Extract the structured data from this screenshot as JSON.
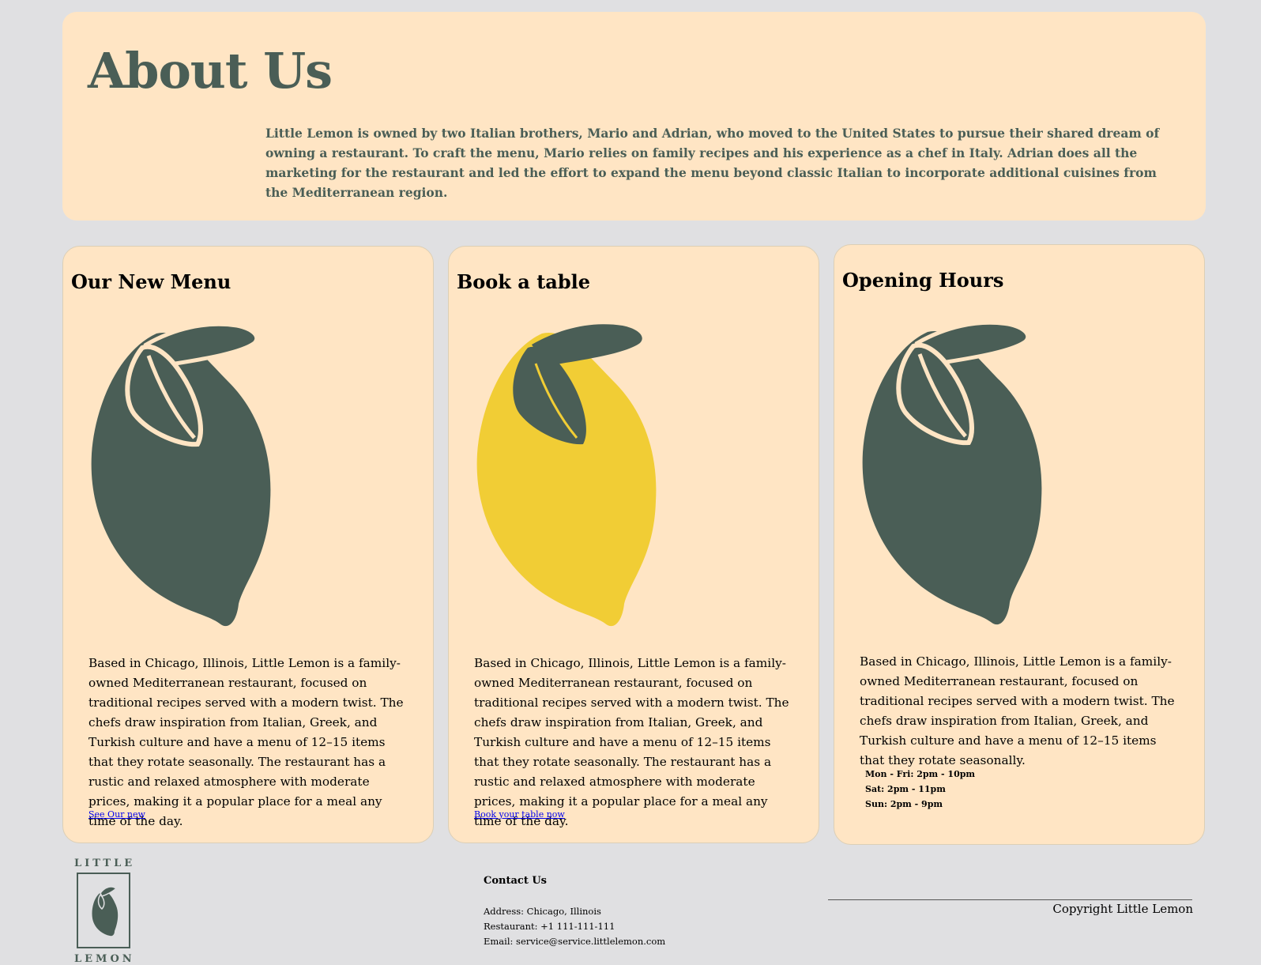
{
  "about": {
    "title": "About Us",
    "text": "Little Lemon is owned by two Italian brothers, Mario and Adrian, who moved to the United States to pursue their shared dream of owning a restaurant. To craft the menu, Mario relies on family recipes and his experience as a chef in Italy. Adrian does all the marketing for the restaurant and led the effort to expand the menu beyond classic Italian to incorporate additional cuisines from the Mediterranean region."
  },
  "cards": [
    {
      "title": "Our New Menu",
      "image": "lemon-dark",
      "body": "Based in Chicago, Illinois, Little Lemon is a family-owned Mediterranean restaurant, focused on traditional recipes served with a modern twist. The chefs draw inspiration from Italian, Greek, and Turkish culture and have a menu of 12–15 items that they rotate seasonally. The restaurant has a rustic and relaxed atmosphere with moderate prices, making it a popular place for a meal any time of the day.",
      "link": "See Our new"
    },
    {
      "title": "Book a table",
      "image": "lemon-yellow",
      "body": "Based in Chicago, Illinois, Little Lemon is a family-owned Mediterranean restaurant, focused on traditional recipes served with a modern twist. The chefs draw inspiration from Italian, Greek, and Turkish culture and have a menu of 12–15 items that they rotate seasonally. The restaurant has a rustic and relaxed atmosphere with moderate prices, making it a popular place for a meal any time of the day.",
      "link": "Book your table now"
    },
    {
      "title": "Opening Hours",
      "image": "lemon-dark",
      "body": "Based in Chicago, Illinois, Little Lemon is a family-owned Mediterranean restaurant, focused on traditional recipes served with a modern twist. The chefs draw inspiration from Italian, Greek, and Turkish culture and have a menu of 12–15 items that they rotate seasonally.",
      "hours": [
        "Mon - Fri: 2pm - 10pm",
        "Sat: 2pm - 11pm",
        "Sun: 2pm - 9pm"
      ]
    }
  ],
  "footer": {
    "logo_top": "LITTLE",
    "logo_bottom": "LEMON",
    "contact_title": "Contact Us",
    "address": "Address: Chicago, Illinois",
    "phone": "Restaurant: +1 111-111-111",
    "email": "Email: service@service.littlelemon.com",
    "copyright": "Copyright Little Lemon"
  },
  "colors": {
    "page_bg": "#e0e0e2",
    "panel_bg": "#ffe5c4",
    "brand_green": "#4a5e56",
    "lemon_yellow": "#f1cd35",
    "link": "#0000ee"
  }
}
